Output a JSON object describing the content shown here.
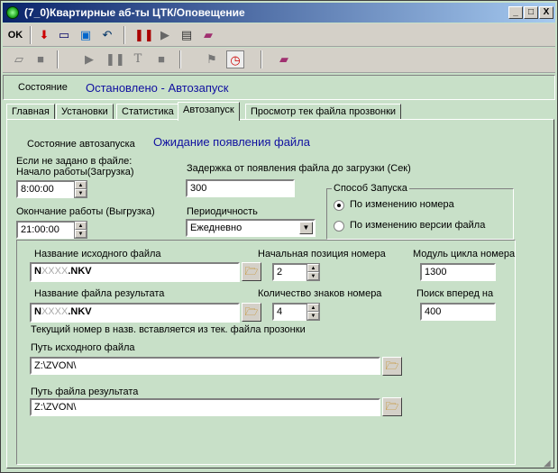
{
  "window": {
    "title": "(7_0)Квартирные аб-ты ЦТК/Оповещение",
    "minimize": "_",
    "maximize": "□",
    "close": "X"
  },
  "toolbar1": {
    "ok_label": "OK"
  },
  "status": {
    "label": "Состояние",
    "value": "Остановлено - Автозапуск"
  },
  "tabs": [
    "Главная",
    "Установки",
    "Статистика",
    "Автозапуск",
    "Просмотр тек файла прозвонки"
  ],
  "active_tab": "Автозапуск",
  "autostart": {
    "state_label": "Состояние автозапуска",
    "state_value": "Ожидание появления файла",
    "if_not_set": "Если не задано в файле:",
    "start_label": "Начало работы(Загрузка)",
    "start_value": "8:00:00",
    "end_label": "Окончание работы (Выгрузка)",
    "end_value": "21:00:00",
    "delay_label": "Задержка от появления файла до загрузки (Сек)",
    "delay_value": "300",
    "period_label": "Периодичность",
    "period_value": "Ежедневно",
    "mode_group": "Способ Запуска",
    "mode_option1": "По изменению номера",
    "mode_option2": "По изменению версии файла",
    "source_name_label": "Название исходного файла",
    "source_name_value_prefix": "N",
    "source_name_value_mid": "XXXX",
    "source_name_value_suffix": ".NKV",
    "start_pos_label": "Начальная позиция номера",
    "start_pos_value": "2",
    "cycle_label": "Модуль цикла номера",
    "cycle_value": "1300",
    "result_name_label": "Название файла результата",
    "result_name_value_prefix": "N",
    "result_name_value_mid": "XXXX",
    "result_name_value_suffix": ".NKV",
    "digits_label": "Количество знаков номера",
    "digits_value": "4",
    "search_label": "Поиск вперед на",
    "search_value": "400",
    "note": "Текущий номер в назв. вставляется из тек. файла прозонки",
    "source_path_label": "Путь исходного файла",
    "source_path_value": "Z:\\ZVON\\",
    "result_path_label": "Путь файла результата",
    "result_path_value": "Z:\\ZVON\\"
  }
}
